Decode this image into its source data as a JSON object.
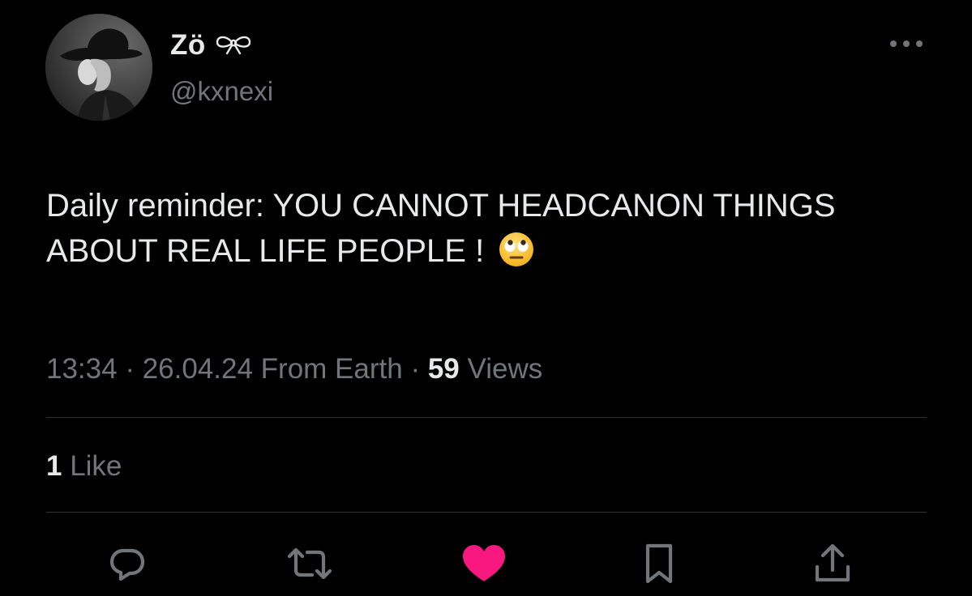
{
  "author": {
    "display_name": "Zö",
    "handle": "@kxnexi"
  },
  "tweet": {
    "text": "Daily reminder: YOU CANNOT HEADCANON THINGS ABOUT REAL LIFE PEOPLE ! ",
    "emoji": "face-with-rolling-eyes"
  },
  "meta": {
    "time": "13:34",
    "sep1": " · ",
    "date": "26.04.24",
    "source": " From Earth",
    "sep2": " · ",
    "views_count": "59",
    "views_label": " Views"
  },
  "engagement": {
    "like_count": "1",
    "like_label": " Like"
  },
  "actions": {
    "reply_icon": "speech-bubble",
    "retweet_icon": "retweet-arrows",
    "like_icon": "heart",
    "bookmark_icon": "bookmark",
    "share_icon": "share-upload"
  },
  "colors": {
    "background": "#000000",
    "primary_text": "#e7e9ea",
    "secondary_text": "#71767b",
    "divider": "#2f3336",
    "like_active": "#f91880"
  }
}
